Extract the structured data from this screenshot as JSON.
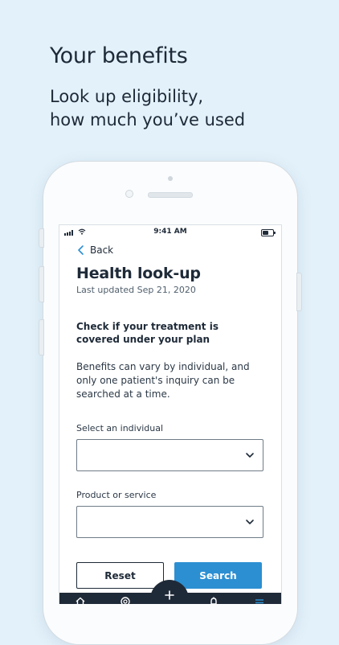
{
  "promo": {
    "headline": "Your benefits",
    "subline_1": "Look up eligibility,",
    "subline_2": "how much you’ve used"
  },
  "status_bar": {
    "time": "9:41 AM"
  },
  "screen": {
    "back_label": "Back",
    "title": "Health look-up",
    "last_updated": "Last updated Sep 21, 2020",
    "question": "Check if your treatment is covered under your plan",
    "info": "Benefits can vary by individual, and only one patient's inquiry can be searched at a time.",
    "individual_field": {
      "label": "Select an individual",
      "value": ""
    },
    "product_field": {
      "label": "Product or service",
      "value": ""
    },
    "reset_label": "Reset",
    "search_label": "Search"
  },
  "tabbar": {
    "icons": [
      "home-icon",
      "card-icon",
      "plus-icon",
      "bell-icon",
      "menu-icon"
    ]
  },
  "colors": {
    "background": "#e3f1fa",
    "text_dark": "#1e2a38",
    "accent": "#2c8fd2",
    "tabbar": "#1f2a38"
  }
}
